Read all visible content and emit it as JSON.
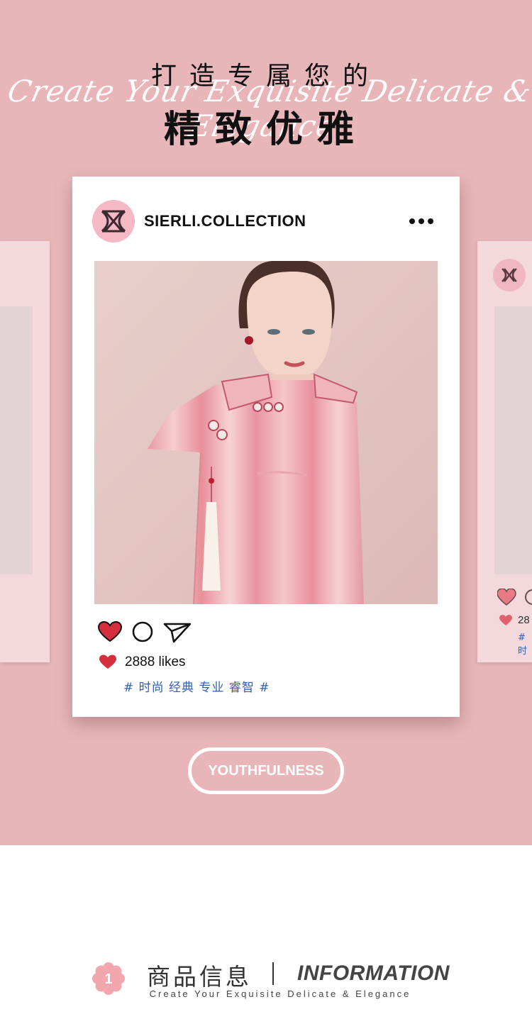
{
  "colors": {
    "background": "#e8b6b9",
    "card": "#ffffff",
    "side_card": "#f4d9dc",
    "heart": "#d32f3f",
    "tag": "#2e5fb5",
    "avatar": "#f5b8c5"
  },
  "header": {
    "title_line1": "打造专属您的",
    "script": "Create Your Exquisite Delicate & Elegance",
    "title_line2": "精致优雅"
  },
  "post": {
    "username": "SIERLI.COLLECTION",
    "avatar_icon": "brand-logo-icon",
    "more_icon": "more-dots-icon",
    "actions": [
      "heart-icon",
      "comment-icon",
      "share-icon"
    ],
    "likes": "2888 likes",
    "tags": "# 时尚 经典 专业 睿智 #"
  },
  "side_card_right": {
    "likes_partial": "28",
    "tag_partial": "# 时"
  },
  "cta": {
    "label": "YOUTHFULNESS"
  },
  "info": {
    "number": "1",
    "title_cn": "商品信息",
    "title_en": "INFORMATION",
    "subtitle": "Create Your Exquisite Delicate & Elegance"
  }
}
